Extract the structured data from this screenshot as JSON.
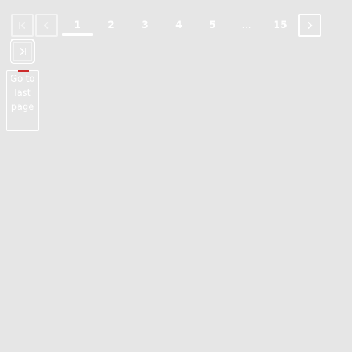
{
  "pagination": {
    "first_icon": "first-page-icon",
    "prev_icon": "chevron-left-icon",
    "next_icon": "chevron-right-icon",
    "last_icon": "last-page-icon",
    "pages": [
      "1",
      "2",
      "3",
      "4",
      "5"
    ],
    "ellipsis": "...",
    "last_page": "15",
    "current_page": "1"
  },
  "tooltip": {
    "text": "Go to last page"
  },
  "colors": {
    "background": "#e6e6e6",
    "foreground": "#ffffff",
    "accent": "#cc2b2b"
  }
}
